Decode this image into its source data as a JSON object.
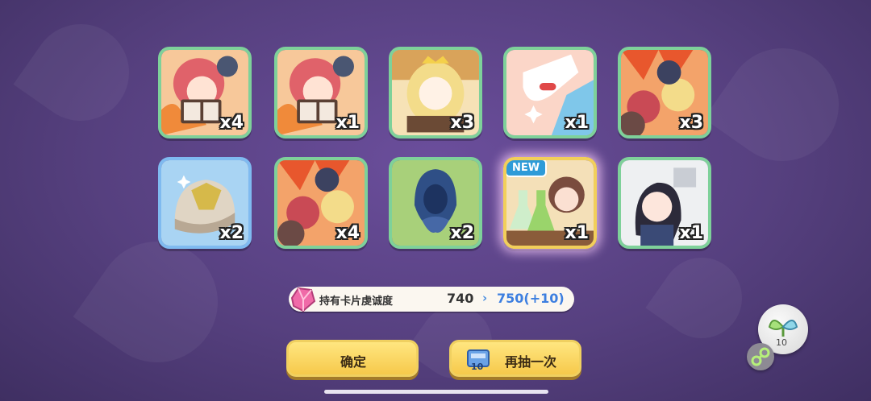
{
  "cards": [
    {
      "qty": "x4",
      "frame": "green",
      "art": "red-hair-book"
    },
    {
      "qty": "x1",
      "frame": "green",
      "art": "red-hair-book"
    },
    {
      "qty": "x3",
      "frame": "green",
      "art": "blonde-crown"
    },
    {
      "qty": "x1",
      "frame": "green",
      "art": "glove-pill"
    },
    {
      "qty": "x3",
      "frame": "green",
      "art": "group-fire"
    },
    {
      "qty": "x2",
      "frame": "blue",
      "art": "helmet-item"
    },
    {
      "qty": "x4",
      "frame": "green",
      "art": "group-fire"
    },
    {
      "qty": "x2",
      "frame": "green",
      "art": "blue-hood"
    },
    {
      "qty": "x1",
      "frame": "gold",
      "art": "lab-flasks",
      "new": "NEW"
    },
    {
      "qty": "x1",
      "frame": "green",
      "art": "dark-hair-girl"
    }
  ],
  "fragment_bar": {
    "label": "持有卡片虔诚度",
    "old_value": "740",
    "arrow": "›",
    "new_value": "750(+10)"
  },
  "buttons": {
    "confirm": "确定",
    "redraw": "再抽一次",
    "ticket_count": "10"
  },
  "sprout_count": "10",
  "colors": {
    "green_frame": "#7ed19a",
    "blue_frame": "#7fbaf0",
    "gold_frame": "#f2cf5a",
    "button": "#f6c94b"
  }
}
